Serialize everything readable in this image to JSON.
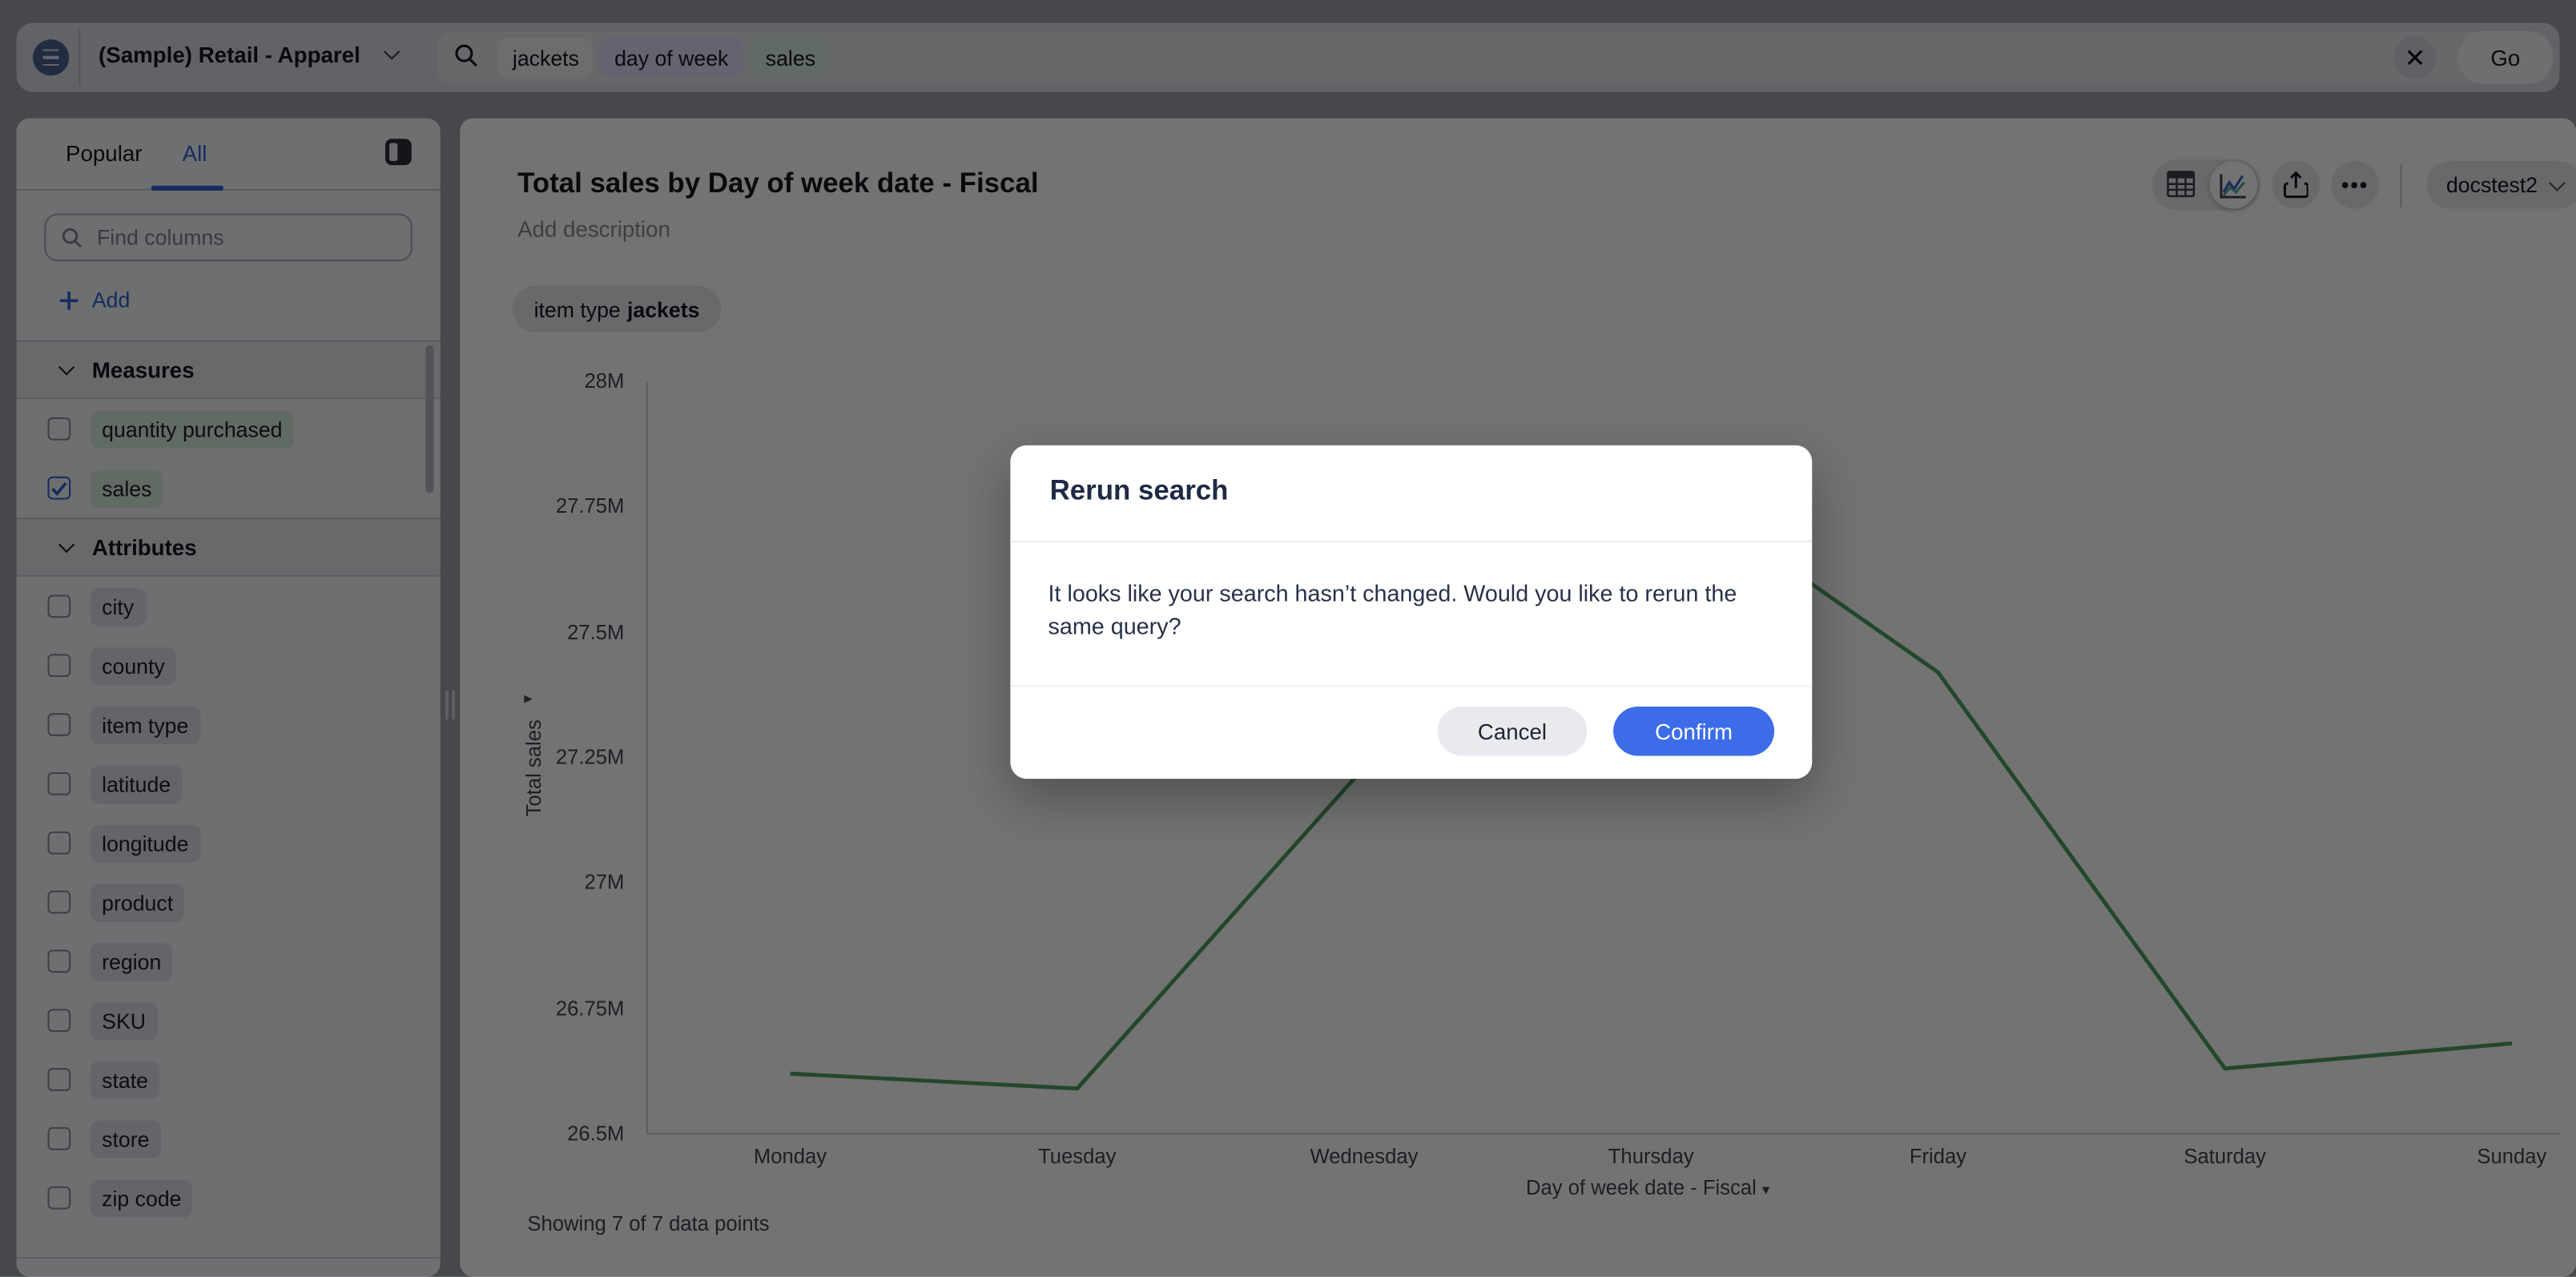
{
  "topbar": {
    "dataset": "(Sample) Retail - Apparel",
    "tokens": [
      {
        "text": "jackets",
        "type": "value"
      },
      {
        "text": "day of week",
        "type": "attribute"
      },
      {
        "text": "sales",
        "type": "measure"
      }
    ],
    "go_label": "Go"
  },
  "sidebar": {
    "tabs": [
      {
        "label": "Popular",
        "active": false
      },
      {
        "label": "All",
        "active": true
      }
    ],
    "find_placeholder": "Find columns",
    "add_label": "Add",
    "measures": {
      "label": "Measures",
      "items": [
        {
          "label": "quantity purchased",
          "checked": false
        },
        {
          "label": "sales",
          "checked": true
        }
      ]
    },
    "attributes": {
      "label": "Attributes",
      "items": [
        {
          "label": "city",
          "checked": false
        },
        {
          "label": "county",
          "checked": false
        },
        {
          "label": "item type",
          "checked": false
        },
        {
          "label": "latitude",
          "checked": false
        },
        {
          "label": "longitude",
          "checked": false
        },
        {
          "label": "product",
          "checked": false
        },
        {
          "label": "region",
          "checked": false
        },
        {
          "label": "SKU",
          "checked": false
        },
        {
          "label": "state",
          "checked": false
        },
        {
          "label": "store",
          "checked": false
        },
        {
          "label": "zip code",
          "checked": false
        }
      ]
    }
  },
  "main": {
    "title": "Total sales by Day of week date - Fiscal",
    "description_placeholder": "Add description",
    "filter_chip": {
      "field": "item type",
      "value": "jackets"
    },
    "workspace": "docstest2",
    "more_glyph": "•••",
    "footer": "Showing 7 of 7 data points"
  },
  "chart_data": {
    "type": "line",
    "title": "Total sales by Day of week date - Fiscal",
    "series": [
      {
        "name": "Total sales",
        "values": [
          26.62,
          26.59,
          27.23,
          27.82,
          27.42,
          26.63,
          26.68
        ]
      }
    ],
    "categories": [
      "Monday",
      "Tuesday",
      "Wednesday",
      "Thursday",
      "Friday",
      "Saturday",
      "Sunday"
    ],
    "unit": "M",
    "ylabel": "Total sales",
    "xlabel": "Day of week date - Fiscal",
    "ylim": [
      26.5,
      28
    ],
    "yticks": [
      "26.5M",
      "26.75M",
      "27M",
      "27.25M",
      "27.5M",
      "27.75M",
      "28M"
    ],
    "grid": false,
    "legend": "none",
    "line_color": "#4E9D63",
    "axis_color": "#C9CCD2"
  },
  "modal": {
    "title": "Rerun search",
    "body": "It looks like your search hasn’t changed. Would you like to rerun the same query?",
    "cancel_label": "Cancel",
    "confirm_label": "Confirm"
  },
  "colors": {
    "accent_blue": "#2E62D1",
    "confirm_blue": "#3C6CE7",
    "line_green": "#4E9D63",
    "measure_pill": "#D9EBDE",
    "attribute_pill": "#DCE0EE",
    "backdrop": "rgba(0,0,0,0.55)"
  }
}
